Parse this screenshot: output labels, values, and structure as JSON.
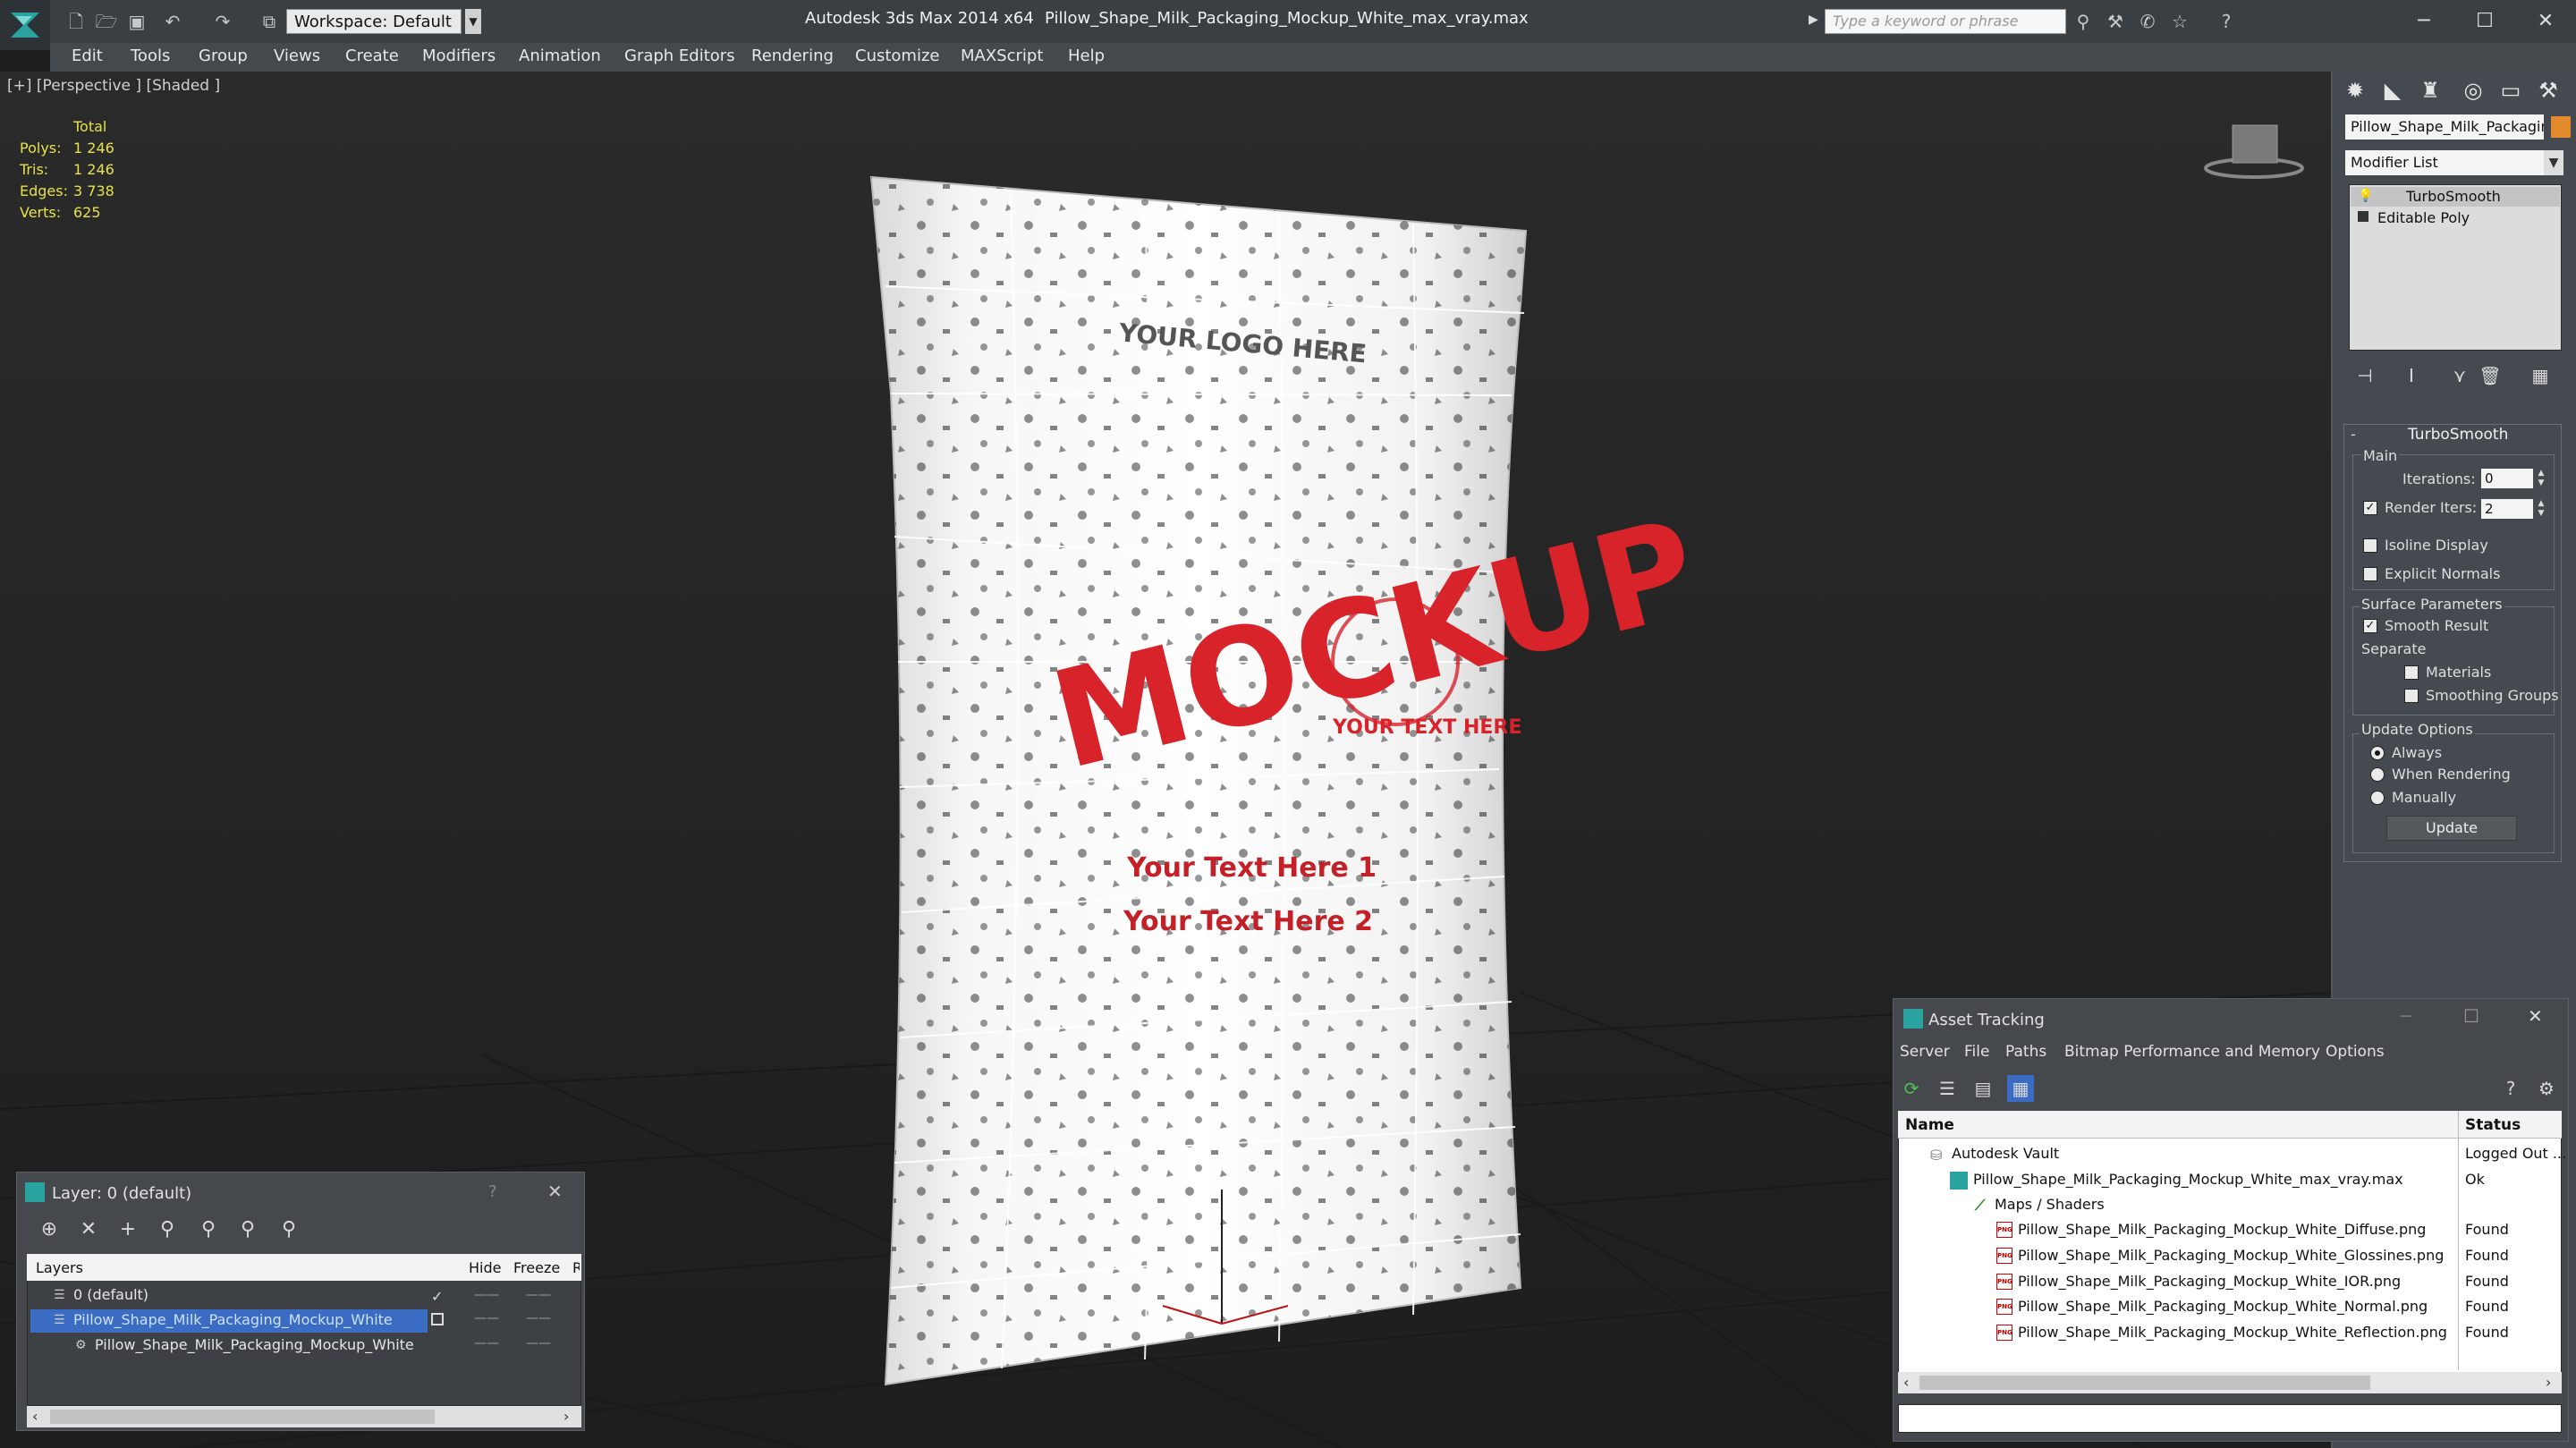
{
  "titlebar": {
    "workspace_label": "Workspace: Default",
    "app_title": "Autodesk 3ds Max  2014 x64",
    "file_title": "Pillow_Shape_Milk_Packaging_Mockup_White_max_vray.max",
    "search_placeholder": "Type a keyword or phrase"
  },
  "menu": [
    "Edit",
    "Tools",
    "Group",
    "Views",
    "Create",
    "Modifiers",
    "Animation",
    "Graph Editors",
    "Rendering",
    "Customize",
    "MAXScript",
    "Help"
  ],
  "viewport": {
    "label": "[+] [Perspective ] [Shaded ]",
    "stats": {
      "total_label": "Total",
      "rows": [
        {
          "label": "Polys:",
          "value": "1 246"
        },
        {
          "label": "Tris:",
          "value": "1 246"
        },
        {
          "label": "Edges:",
          "value": "3 738"
        },
        {
          "label": "Verts:",
          "value": "625"
        }
      ]
    },
    "package": {
      "headline": "MOCKUP",
      "top_text": "YOUR LOGO HERE",
      "seal_text": "YOUR TEXT HERE",
      "text1": "Your Text Here 1",
      "text2": "Your Text Here 2"
    }
  },
  "command_panel": {
    "object_name": "Pillow_Shape_Milk_Packaging",
    "object_color": "#e38a2c",
    "modifier_list": "Modifier List",
    "stack": [
      "TurboSmooth",
      "Editable Poly"
    ],
    "rollout_title": "TurboSmooth",
    "main_label": "Main",
    "iterations_label": "Iterations:",
    "iterations_value": "0",
    "render_iters_label": "Render Iters:",
    "render_iters_value": "2",
    "isoline_label": "Isoline Display",
    "explicit_label": "Explicit Normals",
    "surface_label": "Surface Parameters",
    "smooth_label": "Smooth Result",
    "separate_label": "Separate",
    "materials_label": "Materials",
    "smoothing_label": "Smoothing Groups",
    "update_options_label": "Update Options",
    "always_label": "Always",
    "when_rendering_label": "When Rendering",
    "manually_label": "Manually",
    "update_button": "Update"
  },
  "layer_panel": {
    "title": "Layer: 0 (default)",
    "columns": [
      "Layers",
      "Hide",
      "Freeze",
      "R"
    ],
    "rows": [
      "0 (default)",
      "Pillow_Shape_Milk_Packaging_Mockup_White",
      "Pillow_Shape_Milk_Packaging_Mockup_White"
    ]
  },
  "asset_panel": {
    "title": "Asset Tracking",
    "menu": [
      "Server",
      "File",
      "Paths",
      "Bitmap Performance and Memory",
      "Options"
    ],
    "columns": [
      "Name",
      "Status"
    ],
    "rows": [
      {
        "name": "Autodesk Vault",
        "status": "Logged Out ..."
      },
      {
        "name": "Pillow_Shape_Milk_Packaging_Mockup_White_max_vray.max",
        "status": "Ok"
      },
      {
        "name": "Maps / Shaders",
        "status": ""
      },
      {
        "name": "Pillow_Shape_Milk_Packaging_Mockup_White_Diffuse.png",
        "status": "Found"
      },
      {
        "name": "Pillow_Shape_Milk_Packaging_Mockup_White_Glossines.png",
        "status": "Found"
      },
      {
        "name": "Pillow_Shape_Milk_Packaging_Mockup_White_IOR.png",
        "status": "Found"
      },
      {
        "name": "Pillow_Shape_Milk_Packaging_Mockup_White_Normal.png",
        "status": "Found"
      },
      {
        "name": "Pillow_Shape_Milk_Packaging_Mockup_White_Reflection.png",
        "status": "Found"
      }
    ]
  },
  "colors": {
    "accent_red": "#d8232a",
    "selection_blue": "#3a6cc4"
  }
}
